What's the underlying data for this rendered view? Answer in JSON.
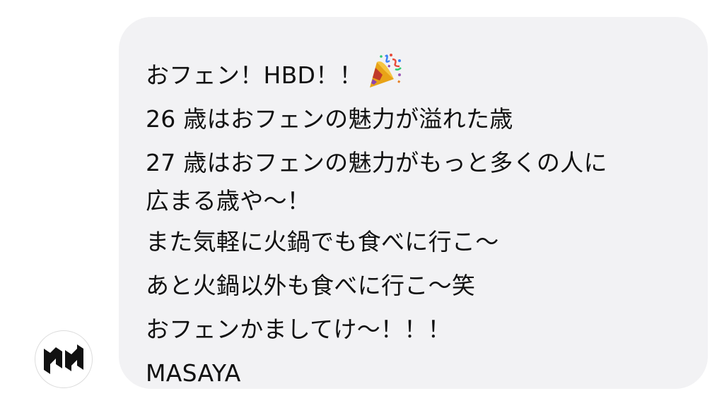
{
  "message": {
    "lines": [
      "おフェン！HBD！！",
      "26 歳はおフェンの魅力が溢れた歳",
      "27 歳はおフェンの魅力がもっと多くの人に",
      "広まる歳や〜！",
      "また気軽に火鍋でも食べに行こ～",
      "あと火鍋以外も食べに行こ～笑",
      "おフェンかましてけ～！！！",
      "MASAYA"
    ],
    "first_line_emoji": "party-popper-icon"
  },
  "avatar": {
    "icon": "hn-logo-icon"
  },
  "colors": {
    "bubble_bg": "#f2f2f4",
    "text": "#111111"
  }
}
